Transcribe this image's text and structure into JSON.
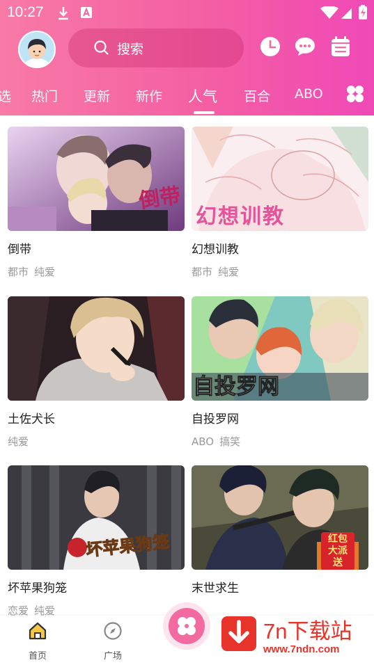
{
  "status_bar": {
    "time": "10:27"
  },
  "search": {
    "placeholder": "搜索"
  },
  "tabs": [
    {
      "label": "选"
    },
    {
      "label": "热门"
    },
    {
      "label": "更新"
    },
    {
      "label": "新作"
    },
    {
      "label": "人气"
    },
    {
      "label": "百合"
    },
    {
      "label": "ABO"
    }
  ],
  "active_tab": "人气",
  "comics": [
    {
      "title": "倒带",
      "tags": [
        "都市",
        "纯爱"
      ],
      "cover_text": "倒带"
    },
    {
      "title": "幻想训教",
      "tags": [
        "都市",
        "纯爱"
      ],
      "cover_text": "幻想训教"
    },
    {
      "title": "土佐犬长",
      "tags": [
        "纯爱"
      ]
    },
    {
      "title": "自投罗网",
      "tags": [
        "ABO",
        "搞笑"
      ],
      "cover_text": "自投罗网"
    },
    {
      "title": "坏苹果狗笼",
      "tags": [
        "恋爱",
        "纯爱"
      ],
      "cover_text": "坏苹果狗笼"
    },
    {
      "title": "末世求生",
      "tags": [],
      "cover_text": "红包大派送"
    }
  ],
  "bottom_nav": [
    {
      "label": "首页",
      "icon": "home-icon"
    },
    {
      "label": "广场",
      "icon": "compass-icon"
    }
  ],
  "watermark": {
    "title": "7n下载站",
    "url": "www.7ndn.com"
  },
  "colors": {
    "accent": "#f45fa3",
    "header_start": "#f87aa6",
    "header_end": "#f049b7",
    "text": "#222222",
    "tag": "#9a9a9a",
    "watermark": "#e8332b"
  }
}
